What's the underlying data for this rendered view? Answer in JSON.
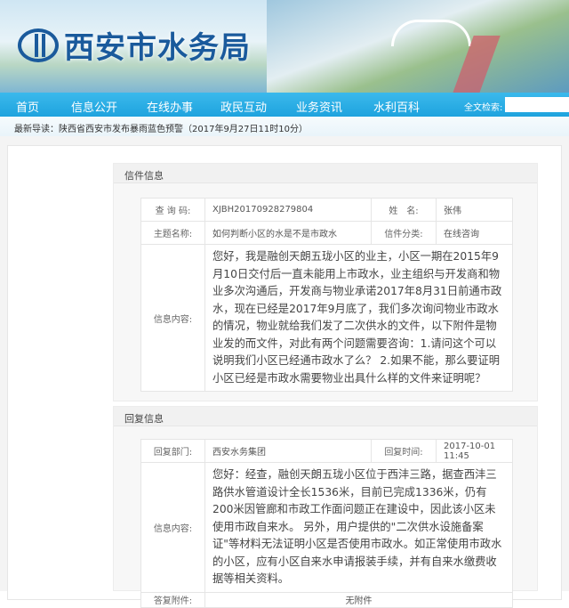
{
  "site": {
    "title": "西安市水务局"
  },
  "nav": {
    "items": [
      "首页",
      "信息公开",
      "在线办事",
      "政民互动",
      "业务资讯",
      "水利百科"
    ],
    "search_label": "全文检索:",
    "search_value": ""
  },
  "news": {
    "text": "最新导读：陕西省西安市发布暴雨蓝色预警（2017年9月27日11时10分）"
  },
  "letter": {
    "heading": "信件信息",
    "query_label": "查 询 码:",
    "query_value": "XJBH20170928279804",
    "name_label": "姓　名:",
    "name_value": "张伟",
    "subject_label": "主题名称:",
    "subject_value": "如何判断小区的水是不是市政水",
    "category_label": "信件分类:",
    "category_value": "在线咨询",
    "content_label": "信息内容:",
    "content": "您好，我是融创天朗五珑小区的业主，小区一期在2015年9月10日交付后一直未能用上市政水，业主组织与开发商和物业多次沟通后，开发商与物业承诺2017年8月31日前通市政水，现在已经是2017年9月底了，我们多次询问物业市政水的情况，物业就给我们发了二次供水的文件，以下附件是物业发的而文件，对此有两个问题需要咨询：1.请问这个可以说明我们小区已经通市政水了么？ 2.如果不能，那么要证明小区已经是市政水需要物业出具什么样的文件来证明呢？"
  },
  "reply": {
    "heading": "回复信息",
    "dept_label": "回复部门:",
    "dept_value": "西安水务集团",
    "time_label": "回复时间:",
    "time_value": "2017-10-01 11:45",
    "content_label": "信息内容:",
    "content": "您好：经查，融创天朗五珑小区位于西沣三路，据查西沣三路供水管道设计全长1536米，目前已完成1336米，仍有200米因管廊和市政工作面问题正在建设中，因此该小区未使用市政自来水。 另外，用户提供的\"二次供水设施备案证\"等材料无法证明小区是否使用市政水。如正常使用市政水的小区，应有小区自来水申请报装手续，并有自来水缴费收据等相关资料。",
    "attach_label": "答复附件:",
    "attach_value": "无附件"
  }
}
